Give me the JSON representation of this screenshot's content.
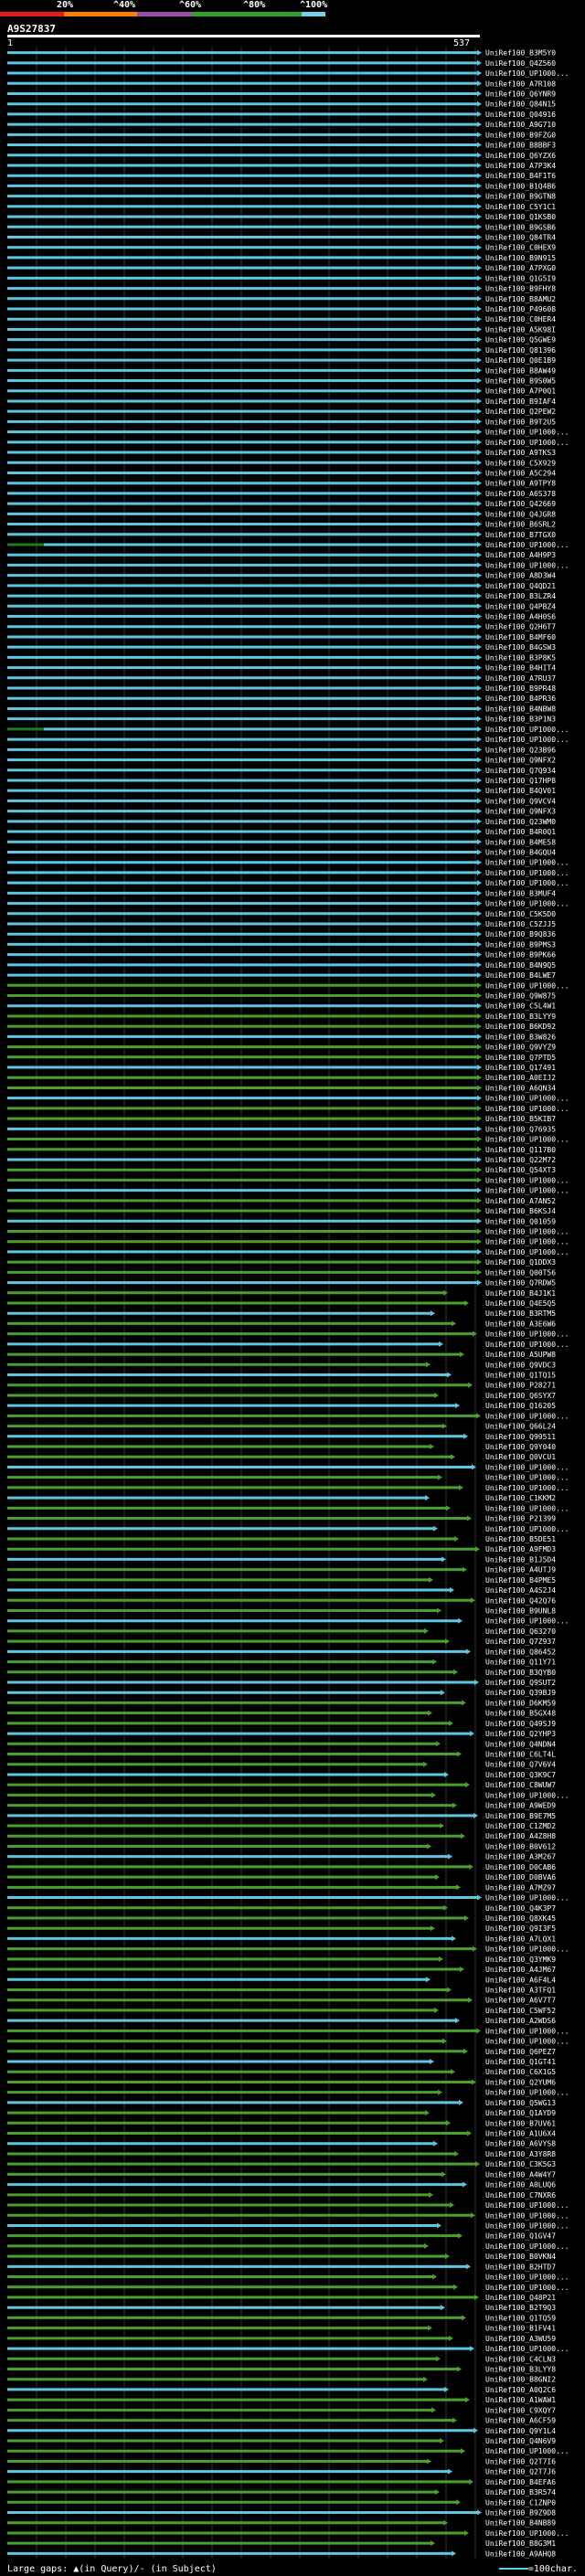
{
  "legend": {
    "labels": [
      "20%",
      "^40%",
      "^60%",
      "^80%",
      "^100%"
    ],
    "colors": [
      "#e41a1c",
      "#ff7f00",
      "#984ea3",
      "#33a02c",
      "#6fd3e8"
    ]
  },
  "query": {
    "id": "A9S27837",
    "start": "1",
    "end": "537"
  },
  "hit_colors": {
    "teal": "#5cc6e0",
    "green": "#4aa02c",
    "darkgreen": "#1f7a1f"
  },
  "hits": [
    "UniRef100_B3M5Y0",
    "UniRef100_Q4Z560",
    "UniRef100_UP1000...",
    "UniRef100_A7R108",
    "UniRef100_Q6YNR9",
    "UniRef100_Q84N15",
    "UniRef100_Q04916",
    "UniRef100_A9G710",
    "UniRef100_B9FZG0",
    "UniRef100_B8BBF3",
    "UniRef100_Q6YZX6",
    "UniRef100_A7P3K4",
    "UniRef100_B4F1T6",
    "UniRef100_B1Q4B6",
    "UniRef100_B9GTN8",
    "UniRef100_C5Y1C1",
    "UniRef100_Q1KSB0",
    "UniRef100_B9GSB6",
    "UniRef100_Q84TR4",
    "UniRef100_C0HEX9",
    "UniRef100_B9N915",
    "UniRef100_A7PXG0",
    "UniRef100_Q1G5I9",
    "UniRef100_B9FHY8",
    "UniRef100_B8AMU2",
    "UniRef100_P49608",
    "UniRef100_C0HER4",
    "UniRef100_A5K98I",
    "UniRef100_Q5GWE9",
    "UniRef100_Q81396",
    "UniRef100_Q0E1B9",
    "UniRef100_B8AW49",
    "UniRef100_B9S0W5",
    "UniRef100_A7P0Q1",
    "UniRef100_B9IAF4",
    "UniRef100_Q2PEW2",
    "UniRef100_B9T2U5",
    "UniRef100_UP1000...",
    "UniRef100_UP1000...",
    "UniRef100_A9TKS3",
    "UniRef100_C5X929",
    "UniRef100_A5C294",
    "UniRef100_A9TPY8",
    "UniRef100_A6S378",
    "UniRef100_Q42669",
    "UniRef100_Q4JGR8",
    "UniRef100_B6SRL2",
    "UniRef100_B7TGX0",
    "UniRef100_UP1000...",
    "UniRef100_A4H9P3",
    "UniRef100_UP1000...",
    "UniRef100_A8D3W4",
    "UniRef100_Q4QD21",
    "UniRef100_B3LZR4",
    "UniRef100_Q4PBZ4",
    "UniRef100_A4H0S6",
    "UniRef100_Q2H6T7",
    "UniRef100_B4MF60",
    "UniRef100_B4GSW3",
    "UniRef100_B3P8K5",
    "UniRef100_B4HIT4",
    "UniRef100_A7RU37",
    "UniRef100_B9PR48",
    "UniRef100_B4PR36",
    "UniRef100_B4NBW8",
    "UniRef100_B3P1N3",
    "UniRef100_UP1000...",
    "UniRef100_UP1000...",
    "UniRef100_Q23B96",
    "UniRef100_Q9NFX2",
    "UniRef100_Q7Q934",
    "UniRef100_Q17HP8",
    "UniRef100_B4QV01",
    "UniRef100_Q9VCV4",
    "UniRef100_Q9NFX3",
    "UniRef100_Q23WM0",
    "UniRef100_B4R0Q1",
    "UniRef100_B4ME58",
    "UniRef100_B4GQU4",
    "UniRef100_UP1000...",
    "UniRef100_UP1000...",
    "UniRef100_UP1000...",
    "UniRef100_B3MUF4",
    "UniRef100_UP1000...",
    "UniRef100_C5K5D0",
    "UniRef100_C5ZJJ5",
    "UniRef100_B9Q836",
    "UniRef100_B9PMS3",
    "UniRef100_B9PK66",
    "UniRef100_B4N9Q5",
    "UniRef100_B4LWE7",
    "UniRef100_UP1000...",
    "UniRef100_Q9W875",
    "UniRef100_C5L4W1",
    "UniRef100_B3LYY9",
    "UniRef100_B6KD92",
    "UniRef100_B3W826",
    "UniRef100_Q9VYZ9",
    "UniRef100_Q7PTD5",
    "UniRef100_Q17491",
    "UniRef100_A0EIJ2",
    "UniRef100_A6QN34",
    "UniRef100_UP1000...",
    "UniRef100_UP1000...",
    "UniRef100_B5KIB7",
    "UniRef100_Q76935",
    "UniRef100_UP1000...",
    "UniRef100_Q117B0",
    "UniRef100_Q22M72",
    "UniRef100_Q54XT3",
    "UniRef100_UP1000...",
    "UniRef100_UP1000...",
    "UniRef100_A7AN52",
    "UniRef100_B6KSJ4",
    "UniRef100_Q01059",
    "UniRef100_UP1000...",
    "UniRef100_UP1000...",
    "UniRef100_UP1000...",
    "UniRef100_Q1DDX3",
    "UniRef100_Q00T56",
    "UniRef100_Q7RDW5",
    "UniRef100_B4J1K1",
    "UniRef100_Q4E5Q5",
    "UniRef100_B3RTM5",
    "UniRef100_A3E6W6",
    "UniRef100_UP1000...",
    "UniRef100_UP1000...",
    "UniRef100_A5UPW8",
    "UniRef100_Q9VDC3",
    "UniRef100_Q1TQ15",
    "UniRef100_P28271",
    "UniRef100_Q6SYX7",
    "UniRef100_Q16205",
    "UniRef100_UP1000...",
    "UniRef100_Q66L24",
    "UniRef100_Q99511",
    "UniRef100_Q9Y040",
    "UniRef100_Q0VCU1",
    "UniRef100_UP1000...",
    "UniRef100_UP1000...",
    "UniRef100_UP1000...",
    "UniRef100_C1KKM2",
    "UniRef100_UP1000...",
    "UniRef100_P21399",
    "UniRef100_UP1000...",
    "UniRef100_B5DE51",
    "UniRef100_A9FMD3",
    "UniRef100_B1J5D4",
    "UniRef100_A4UTJ9",
    "UniRef100_B4PME5",
    "UniRef100_A4S2J4",
    "UniRef100_Q42Q76",
    "UniRef100_B9UNL8",
    "UniRef100_UP1000...",
    "UniRef100_Q63270",
    "UniRef100_Q7Z937",
    "UniRef100_Q86452",
    "UniRef100_Q11Y71",
    "UniRef100_B3QYB0",
    "UniRef100_Q9SUT2",
    "UniRef100_Q39BJ9",
    "UniRef100_D6KM59",
    "UniRef100_B5GX48",
    "UniRef100_Q49SJ9",
    "UniRef100_Q2YHP3",
    "UniRef100_Q4NDN4",
    "UniRef100_C6LT4L",
    "UniRef100_Q7V6V4",
    "UniRef100_Q3K9C7",
    "UniRef100_C8WUW7",
    "UniRef100_UP1000...",
    "UniRef100_A9WED9",
    "UniRef100_B9E7M5",
    "UniRef100_C1ZMD2",
    "UniRef100_A4Z8H8",
    "UniRef100_B0V612",
    "UniRef100_A3M267",
    "UniRef100_D0CAB6",
    "UniRef100_D0BVA6",
    "UniRef100_A7MZ97",
    "UniRef100_UP1000...",
    "UniRef100_Q4K3P7",
    "UniRef100_Q8XK45",
    "UniRef100_Q9I3F5",
    "UniRef100_A7LQX1",
    "UniRef100_UP1000...",
    "UniRef100_Q3YMK9",
    "UniRef100_A4JM67",
    "UniRef100_A6F4L4",
    "UniRef100_A3TFQ1",
    "UniRef100_A6V7T7",
    "UniRef100_C5WF52",
    "UniRef100_A2WDS6",
    "UniRef100_UP1000...",
    "UniRef100_UP1000...",
    "UniRef100_Q6PEZ7",
    "UniRef100_Q1GT41",
    "UniRef100_C6X1G5",
    "UniRef100_Q2YUM6",
    "UniRef100_UP1000...",
    "UniRef100_Q5WG13",
    "UniRef100_Q1AYD9",
    "UniRef100_B7UV61",
    "UniRef100_A1U6X4",
    "UniRef100_A6VYS8",
    "UniRef100_A3Y8R8",
    "UniRef100_C3K5G3",
    "UniRef100_A4W4Y7",
    "UniRef100_A0LUQ6",
    "UniRef100_C7NXR6",
    "UniRef100_UP1000...",
    "UniRef100_UP1000...",
    "UniRef100_UP1000...",
    "UniRef100_Q1GV47",
    "UniRef100_UP1000...",
    "UniRef100_B0VKN4",
    "UniRef100_B2HTD7",
    "UniRef100_UP1000...",
    "UniRef100_UP1000...",
    "UniRef100_Q48P21",
    "UniRef100_B2T9Q3",
    "UniRef100_Q1TQ59",
    "UniRef100_B1FV41",
    "UniRef100_A3WU59",
    "UniRef100_UP1000...",
    "UniRef100_C4CLN3",
    "UniRef100_B3LYY8",
    "UniRef100_B8GNI2",
    "UniRef100_A0Q2C6",
    "UniRef100_A1WAW1",
    "UniRef100_C9XQY7",
    "UniRef100_A6CF59",
    "UniRef100_Q9Y1L4",
    "UniRef100_Q4N6V9",
    "UniRef100_UP1000...",
    "UniRef100_Q2T7I6",
    "UniRef100_Q2T7J6",
    "UniRef100_B4EFA6",
    "UniRef100_B3R574",
    "UniRef100_C1ZNP0",
    "UniRef100_B9Z9D8",
    "UniRef100_B4NB89",
    "UniRef100_UP1000...",
    "UniRef100_B8G3M1",
    "UniRef100_A9AHQ8"
  ],
  "footer": {
    "left": "Large gaps: ▲(in Query)/- (in Subject)",
    "right": "=100char."
  }
}
